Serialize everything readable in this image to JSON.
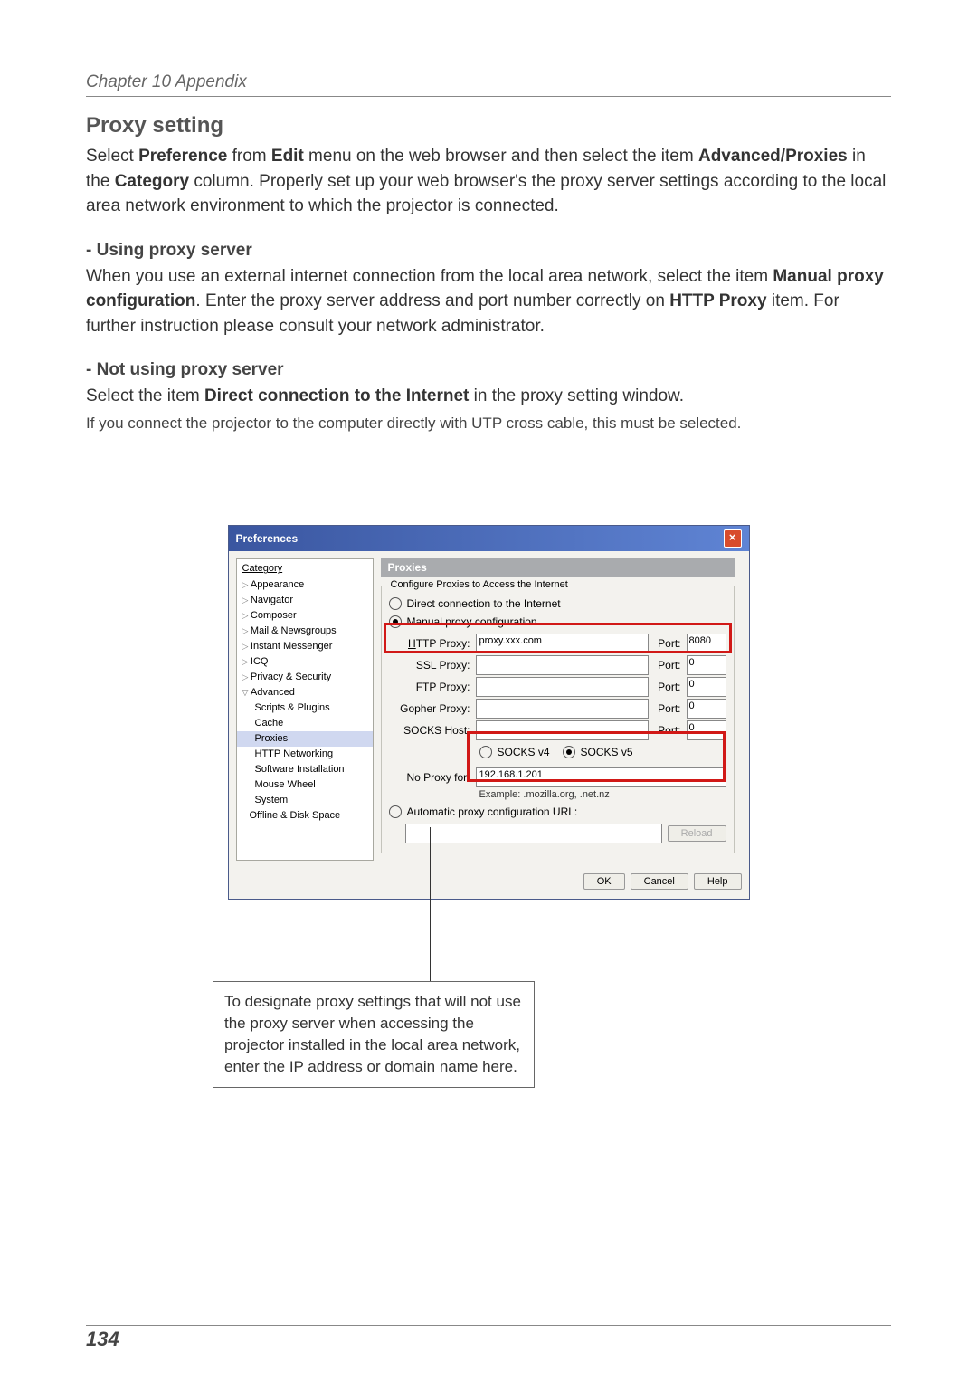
{
  "chapter_header": "Chapter 10 Appendix",
  "section_title": "Proxy setting",
  "intro": {
    "select": "Select ",
    "preference": "Preference",
    "from": " from ",
    "edit": "Edit",
    "mid1": " menu on the web browser and then select the item ",
    "adv": "Advanced/Proxies",
    "mid2": " in the ",
    "cat": "Category",
    "rest": " column. Properly set up your web browser's the proxy server settings according to the local area network environment to which the projector is connected."
  },
  "using_heading": "- Using proxy server",
  "using": {
    "p1": "When you use an external internet connection from the local area network, select the item ",
    "manual": "Manual proxy configuration",
    "p2": ". Enter the proxy server address and port number correctly on ",
    "http": "HTTP Proxy",
    "p3": " item. For further instruction please consult your network administrator."
  },
  "not_heading": "- Not using proxy server",
  "not": {
    "p1": "Select the item ",
    "direct": "Direct connection to the Internet",
    "p2": " in the proxy setting window."
  },
  "note_text": "If you connect the projector to the computer directly with UTP cross cable, this must be selected.",
  "dialog": {
    "title": "Preferences",
    "cat_title": "Category",
    "cats": {
      "appearance": "Appearance",
      "navigator": "Navigator",
      "composer": "Composer",
      "mail": "Mail & Newsgroups",
      "im": "Instant Messenger",
      "icq": "ICQ",
      "privacy": "Privacy & Security",
      "advanced": "Advanced",
      "scripts": "Scripts & Plugins",
      "cache": "Cache",
      "proxies": "Proxies",
      "httpnet": "HTTP Networking",
      "swinst": "Software Installation",
      "mouse": "Mouse Wheel",
      "system": "System",
      "offline": "Offline & Disk Space"
    },
    "panel_title": "Proxies",
    "group_legend": "Configure Proxies to Access the Internet",
    "radios": {
      "direct": "Direct connection to the Internet",
      "manual": "Manual proxy configuration",
      "auto": "Automatic proxy configuration URL:"
    },
    "labels": {
      "http": "HTTP Proxy:",
      "ssl": "SSL Proxy:",
      "ftp": "FTP Proxy:",
      "gopher": "Gopher Proxy:",
      "socks": "SOCKS Host:",
      "noproxy": "No Proxy for:",
      "port": "Port:",
      "socks4": "SOCKS v4",
      "socks5": "SOCKS v5",
      "example": "Example: .mozilla.org, .net.nz"
    },
    "values": {
      "http_host": "proxy.xxx.com",
      "http_port": "8080",
      "ssl_port": "0",
      "ftp_port": "0",
      "gopher_port": "0",
      "socks_port": "0",
      "noproxy": "192.168.1.201",
      "auto_url": ""
    },
    "buttons": {
      "reload": "Reload",
      "ok": "OK",
      "cancel": "Cancel",
      "help": "Help"
    }
  },
  "callout": "To designate proxy settings that will not use the proxy server when accessing the projector installed in the local area network, enter the IP address or domain name here.",
  "page_number": "134"
}
